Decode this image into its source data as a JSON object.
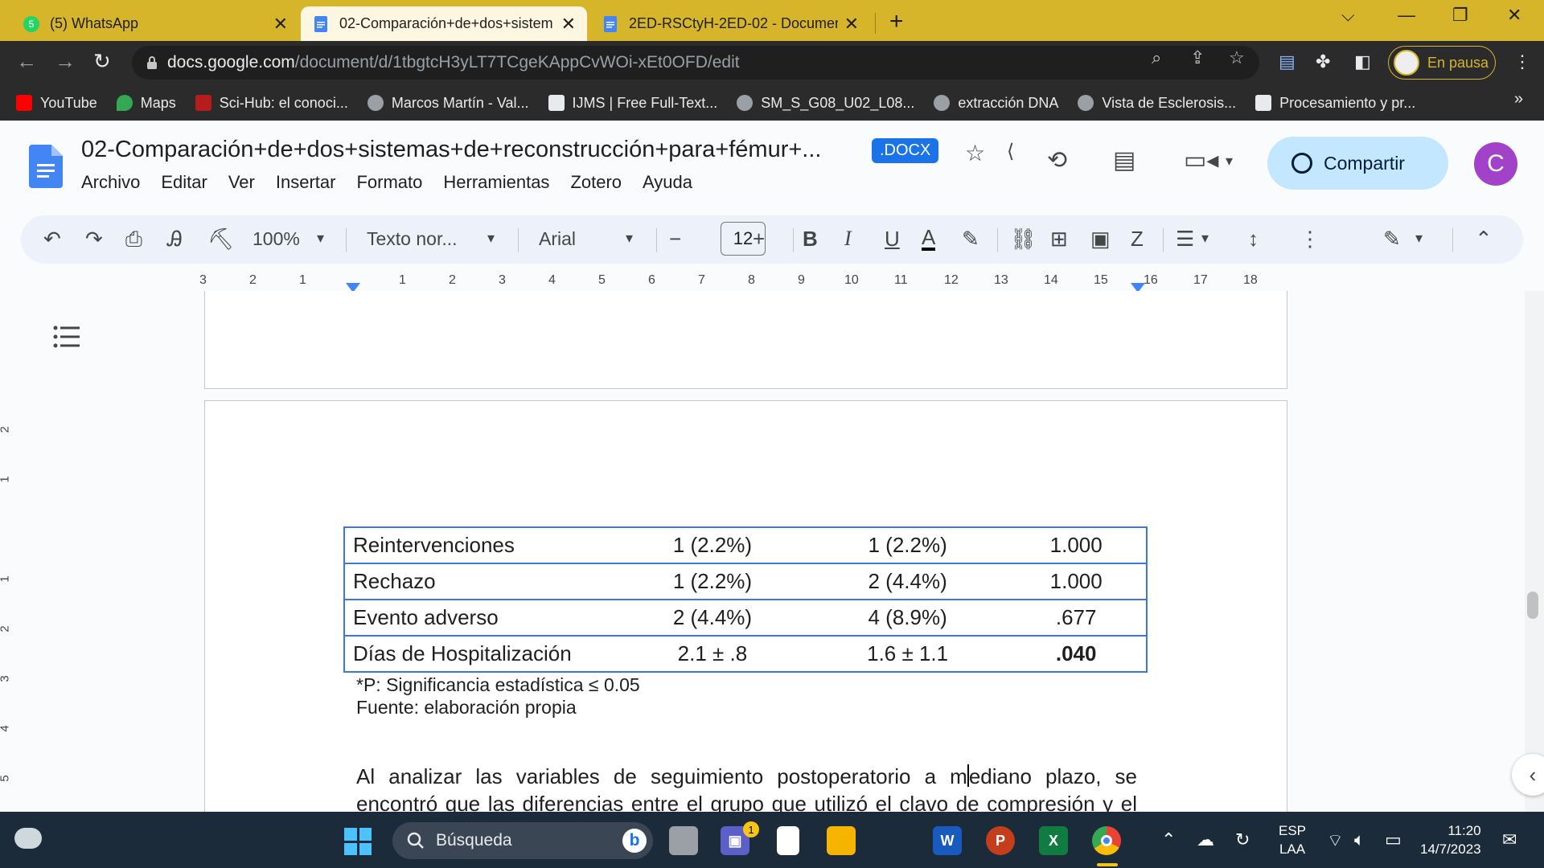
{
  "browser": {
    "tabs": [
      {
        "label": "(5) WhatsApp",
        "active": false
      },
      {
        "label": "02-Comparación+de+dos+sistem",
        "active": true
      },
      {
        "label": "2ED-RSCtyH-2ED-02 - Document",
        "active": false
      }
    ],
    "url_host": "docs.google.com",
    "url_path": "/document/d/1tbgtcH3yLT7TCgeKAppCvWOi-xEt0OFD/edit",
    "profile_status": "En pausa",
    "bookmarks": [
      {
        "label": "YouTube",
        "color": "#ff0000"
      },
      {
        "label": "Maps",
        "color": "#34a853"
      },
      {
        "label": "Sci-Hub: el conoci...",
        "color": "#b71c1c"
      },
      {
        "label": "Marcos Martín - Val...",
        "color": "#9aa0a6"
      },
      {
        "label": "IJMS | Free Full-Text...",
        "color": "#e8eaed"
      },
      {
        "label": "SM_S_G08_U02_L08...",
        "color": "#9aa0a6"
      },
      {
        "label": "extracción DNA",
        "color": "#9aa0a6"
      },
      {
        "label": "Vista de Esclerosis...",
        "color": "#9aa0a6"
      },
      {
        "label": "Procesamiento y pr...",
        "color": "#e8eaed"
      }
    ]
  },
  "docs": {
    "title": "02-Comparación+de+dos+sistemas+de+reconstrucción+para+fémur+...",
    "badge": ".DOCX",
    "menus": [
      "Archivo",
      "Editar",
      "Ver",
      "Insertar",
      "Formato",
      "Herramientas",
      "Zotero",
      "Ayuda"
    ],
    "share_label": "Compartir",
    "avatar_letter": "C",
    "toolbar": {
      "zoom": "100%",
      "style": "Texto nor...",
      "font": "Arial",
      "font_size": "12"
    },
    "ruler_numbers": [
      "3",
      "2",
      "1",
      "1",
      "2",
      "3",
      "4",
      "5",
      "6",
      "7",
      "8",
      "9",
      "10",
      "11",
      "12",
      "13",
      "14",
      "15",
      "16",
      "17",
      "18"
    ],
    "vruler_numbers": [
      "2",
      "1",
      "1",
      "2",
      "3",
      "4",
      "5"
    ]
  },
  "document": {
    "table_rows": [
      {
        "label": "Reintervenciones",
        "g1": "1 (2.2%)",
        "g2": "1 (2.2%)",
        "p": "1.000",
        "bold": false
      },
      {
        "label": "Rechazo",
        "g1": "1 (2.2%)",
        "g2": "2 (4.4%)",
        "p": "1.000",
        "bold": false
      },
      {
        "label": "Evento adverso",
        "g1": "2 (4.4%)",
        "g2": "4 (8.9%)",
        "p": ".677",
        "bold": false
      },
      {
        "label": "Días de Hospitalización",
        "g1": "2.1 ± .8",
        "g2": "1.6 ± 1.1",
        "p": ".040",
        "bold": true
      }
    ],
    "footnote_1": "*P: Significancia estadística ≤ 0.05",
    "footnote_2": "Fuente: elaboración propia",
    "para_line1_a": "Al analizar las variables de seguimiento postoperatorio a m",
    "para_line1_b": "ediano plazo, se",
    "para_line2": "encontró que las diferencias entre el grupo que utilizó el clavo de compresión y el"
  },
  "taskbar": {
    "search_placeholder": "Búsqueda",
    "teams_badge": "1",
    "lang_1": "ESP",
    "lang_2": "LAA",
    "time": "11:20",
    "date": "14/7/2023"
  }
}
